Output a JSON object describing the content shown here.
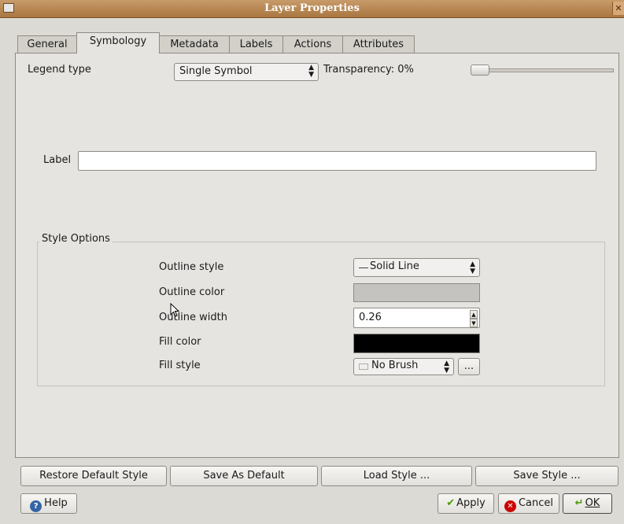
{
  "window": {
    "title": "Layer Properties",
    "close_glyph": "✕"
  },
  "tabs": [
    {
      "label": "General"
    },
    {
      "label": "Symbology"
    },
    {
      "label": "Metadata"
    },
    {
      "label": "Labels"
    },
    {
      "label": "Actions"
    },
    {
      "label": "Attributes"
    }
  ],
  "symbology": {
    "legend_type_label": "Legend type",
    "legend_type_value": "Single Symbol",
    "transparency_label": "Transparency: 0%",
    "transparency_value": 0,
    "label_label": "Label",
    "label_value": ""
  },
  "style_options": {
    "group_title": "Style Options",
    "outline_style_label": "Outline style",
    "outline_style_value": "Solid Line",
    "outline_color_label": "Outline color",
    "outline_color": "#c4c3bf",
    "outline_width_label": "Outline width",
    "outline_width_value": "0.26",
    "fill_color_label": "Fill color",
    "fill_color": "#000000",
    "fill_style_label": "Fill style",
    "fill_style_value": "No Brush",
    "more_button": "..."
  },
  "style_buttons": {
    "restore": "Restore Default Style",
    "save_default": "Save As Default",
    "load": "Load Style ...",
    "save": "Save Style ..."
  },
  "dialog_buttons": {
    "help": "Help",
    "apply": "Apply",
    "cancel": "Cancel",
    "ok": "OK"
  },
  "icons": {
    "help": "help-icon",
    "apply": "checkmark-icon",
    "cancel": "cancel-icon",
    "ok": "enter-arrow-icon"
  }
}
